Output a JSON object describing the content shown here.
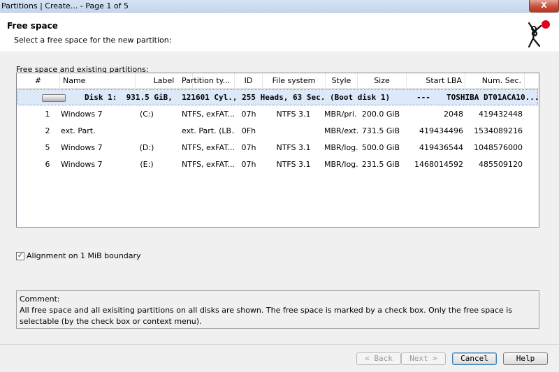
{
  "window": {
    "title": "Partitions | Create...  -  Page 1 of 5",
    "close_label": "X"
  },
  "header": {
    "title": "Free space",
    "subtitle": "Select a free space for the new partition:"
  },
  "group_label": "Free space and existing partitions:",
  "table": {
    "columns": [
      "#",
      "Name",
      "Label",
      "Partition ty...",
      "ID",
      "File system",
      "Style",
      "Size",
      "Start LBA",
      "Num. Sec."
    ],
    "disk": {
      "text": "Disk 1:  931.5 GiB,  121601 Cyl., 255 Heads, 63 Sec. (Boot disk 1)",
      "dashes": "---",
      "model": "TOSHIBA DT01ACA10..."
    },
    "rows": [
      {
        "num": "1",
        "name": "Windows 7",
        "label": "(C:)",
        "ptype": "NTFS, exFAT...",
        "id": "07h",
        "fs": "NTFS 3.1",
        "style": "MBR/pri.",
        "size": "200.0 GiB",
        "start": "2048",
        "sectors": "419432448"
      },
      {
        "num": "2",
        "name": "ext. Part.",
        "label": "",
        "ptype": "ext. Part. (LB...",
        "id": "0Fh",
        "fs": "",
        "style": "MBR/ext.",
        "size": "731.5 GiB",
        "start": "419434496",
        "sectors": "1534089216"
      },
      {
        "num": "5",
        "name": "Windows 7",
        "label": "(D:)",
        "ptype": "NTFS, exFAT...",
        "id": "07h",
        "fs": "NTFS 3.1",
        "style": "MBR/log.",
        "size": "500.0 GiB",
        "start": "419436544",
        "sectors": "1048576000"
      },
      {
        "num": "6",
        "name": "Windows 7",
        "label": "(E:)",
        "ptype": "NTFS, exFAT...",
        "id": "07h",
        "fs": "NTFS 3.1",
        "style": "MBR/log.",
        "size": "231.5 GiB",
        "start": "1468014592",
        "sectors": "485509120"
      }
    ]
  },
  "alignment": {
    "checked": true,
    "check_mark": "✓",
    "label": "Alignment on 1 MiB boundary"
  },
  "comment": {
    "title": "Comment:",
    "text": "All free space and all exisiting partitions on all disks are shown. The free space is marked by a check box. Only the free space is selectable (by the check box or context menu)."
  },
  "buttons": {
    "back": "< Back",
    "next": "Next >",
    "cancel": "Cancel",
    "help": "Help"
  },
  "colors": {
    "selected_row": "#dde9f8",
    "background": "#f0f0f0",
    "logo_dot": "#e3001b"
  }
}
